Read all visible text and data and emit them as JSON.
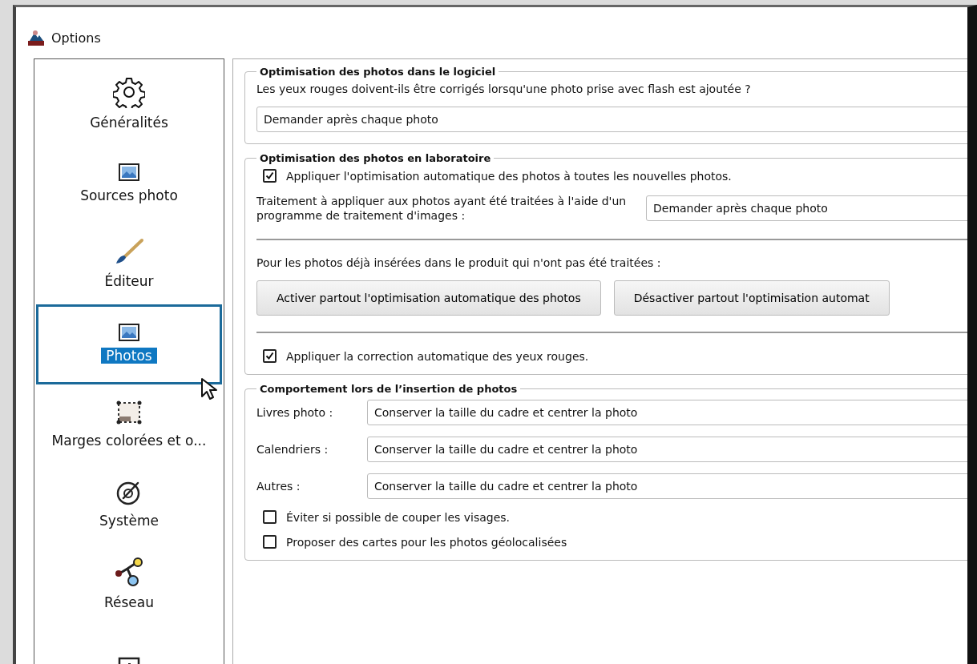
{
  "window": {
    "title": "Options"
  },
  "sidebar": {
    "items": [
      {
        "kind": "gear",
        "label": "Généralités",
        "selected": false
      },
      {
        "kind": "picture",
        "label": "Sources photo",
        "selected": false
      },
      {
        "kind": "brush",
        "label": "Éditeur",
        "selected": false
      },
      {
        "kind": "picture",
        "label": "Photos",
        "selected": true
      },
      {
        "kind": "frame",
        "label": "Marges colorées et o...",
        "selected": false
      },
      {
        "kind": "dial",
        "label": "Système",
        "selected": false
      },
      {
        "kind": "network",
        "label": "Réseau",
        "selected": false
      },
      {
        "kind": "info",
        "selected": false
      }
    ]
  },
  "software_group": {
    "title": "Optimisation des photos dans le logiciel",
    "question": "Les yeux rouges doivent-ils être corrigés lorsqu'une photo prise avec flash est ajoutée ?",
    "dropdown": "Demander après chaque photo"
  },
  "lab_group": {
    "title": "Optimisation des photos en laboratoire",
    "auto_checkbox": {
      "label": "Appliquer l'optimisation automatique des photos à toutes les nouvelles photos.",
      "checked": true
    },
    "treatment_label": "Traitement à appliquer aux photos ayant été traitées à l'aide d'un programme de traitement d'images :",
    "treatment_dropdown": "Demander après chaque photo",
    "existing_label": "Pour les photos déjà insérées dans le produit qui n'ont pas été traitées :",
    "buttons": [
      "Activer partout l'optimisation automatique des photos",
      "Désactiver partout l'optimisation automat"
    ],
    "redeye_checkbox": {
      "label": "Appliquer la correction automatique des yeux rouges.",
      "checked": true
    }
  },
  "insertion_group": {
    "title": "Comportement lors de l’insertion de photos",
    "rows": [
      {
        "label": "Livres photo :",
        "value": "Conserver la taille du cadre et centrer la photo"
      },
      {
        "label": "Calendriers :",
        "value": "Conserver la taille du cadre et centrer la photo"
      },
      {
        "label": "Autres :",
        "value": "Conserver la taille du cadre et centrer la photo"
      }
    ],
    "checkboxes": [
      {
        "label": "Éviter si possible de couper les visages.",
        "checked": false
      },
      {
        "label": "Proposer des cartes pour les photos géolocalisées",
        "checked": false
      }
    ]
  }
}
